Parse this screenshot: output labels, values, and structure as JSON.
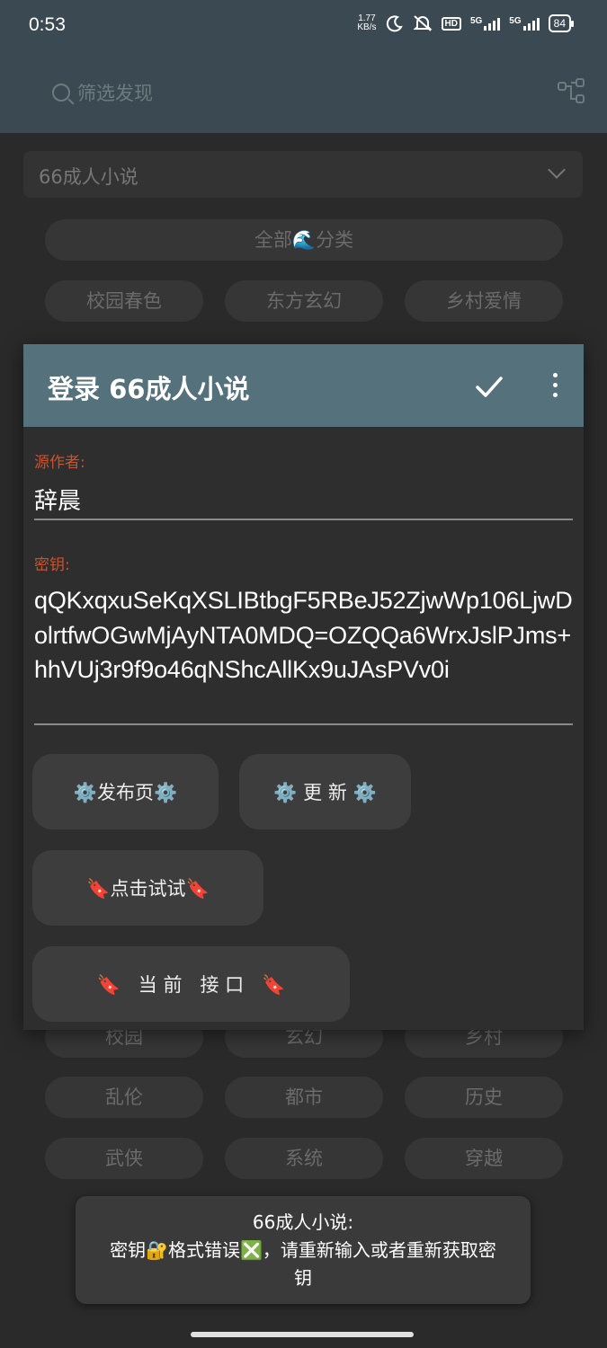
{
  "status_bar": {
    "time": "0:53",
    "speed_value": "1.77",
    "speed_unit": "KB/s",
    "hd_badge": "HD",
    "net1": "5G",
    "net2": "5G",
    "battery": "84"
  },
  "search": {
    "placeholder": "筛选发现"
  },
  "source_select": {
    "value": "66成人小说"
  },
  "chips_top": [
    "全部🌊分类",
    "校园春色",
    "东方玄幻",
    "乡村爱情"
  ],
  "chips_bottom": [
    "校园",
    "玄幻",
    "乡村",
    "乱伦",
    "都市",
    "历史",
    "武侠",
    "系统",
    "穿越"
  ],
  "dialog": {
    "title": "登录 66成人小说",
    "author_label": "源作者:",
    "author_value": "辞晨",
    "key_label": "密钥:",
    "key_value": "qQKxqxuSeKqXSLIBtbgF5RBeJ52ZjwWp106LjwDolrtfwOGwMjAyNTA0MDQ=OZQQa6WrxJslPJms+hhVUj3r9f9o46qNShcAllKx9uJAsPVv0i",
    "buttons": {
      "publish": "⚙️发布页⚙️",
      "update": "⚙️ 更  新 ⚙️",
      "try": "🔖点击试试🔖",
      "current": "🔖   当 前   接 口   🔖"
    }
  },
  "toast": {
    "line1": "66成人小说:",
    "line2": "密钥🔐格式错误❎，请重新输入或者重新获取密钥"
  }
}
